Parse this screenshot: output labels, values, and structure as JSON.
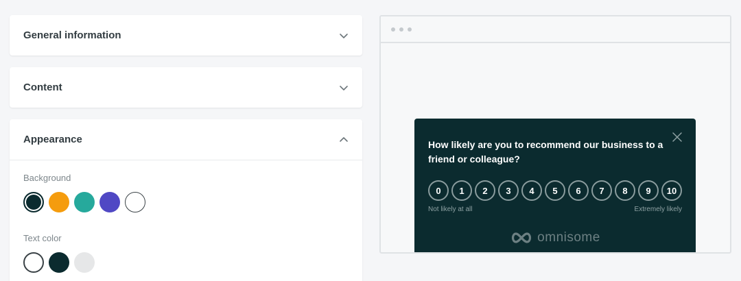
{
  "panels": {
    "general": {
      "title": "General information",
      "state": "collapsed"
    },
    "content": {
      "title": "Content",
      "state": "collapsed"
    },
    "appearance": {
      "title": "Appearance",
      "state": "expanded",
      "background": {
        "label": "Background",
        "swatches": [
          {
            "color": "#0b2b2f",
            "selected": true
          },
          {
            "color": "#f59c0e",
            "selected": false
          },
          {
            "color": "#26a99c",
            "selected": false
          },
          {
            "color": "#5048c4",
            "selected": false
          },
          {
            "color": "#ffffff",
            "selected": false
          }
        ]
      },
      "text_color": {
        "label": "Text color",
        "swatches": [
          {
            "color": "#ffffff",
            "selected": true
          },
          {
            "color": "#0b2b2f",
            "selected": false
          },
          {
            "color": "#e6e7e8",
            "selected": false
          }
        ]
      }
    }
  },
  "preview": {
    "widget": {
      "question": "How likely are you to recommend our business to a friend or colleague?",
      "scale": [
        "0",
        "1",
        "2",
        "3",
        "4",
        "5",
        "6",
        "7",
        "8",
        "9",
        "10"
      ],
      "low_label": "Not likely at all",
      "high_label": "Extremely likely",
      "brand": "omnisome",
      "background": "#0b2b2f"
    }
  }
}
